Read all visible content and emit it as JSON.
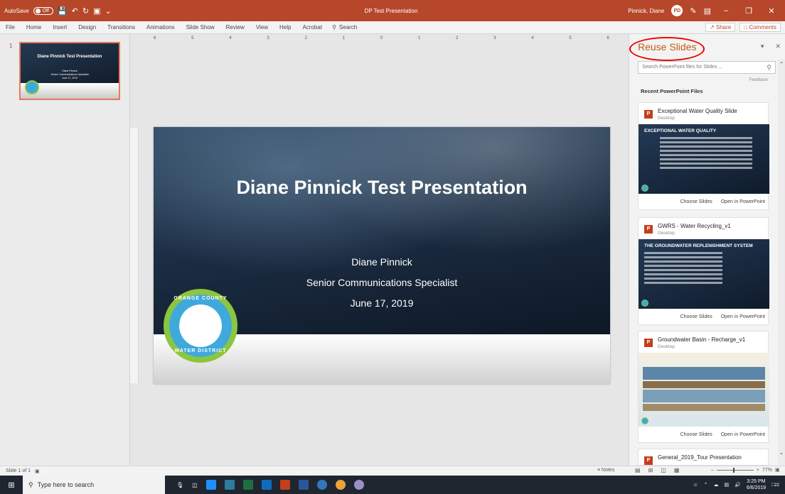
{
  "window": {
    "autosave_label": "AutoSave",
    "autosave_state": "Off",
    "title": "DP Test Presentation",
    "user_name": "Pinnick, Diane",
    "user_initials": "PD"
  },
  "ribbon": {
    "tabs": [
      "File",
      "Home",
      "Insert",
      "Design",
      "Transitions",
      "Animations",
      "Slide Show",
      "Review",
      "View",
      "Help",
      "Acrobat"
    ],
    "search_label": "Search",
    "share_label": "Share",
    "comments_label": "Comments"
  },
  "ruler_ticks": [
    "6",
    "5",
    "4",
    "3",
    "2",
    "1",
    "0",
    "1",
    "2",
    "3",
    "4",
    "5",
    "6"
  ],
  "thumbnails": [
    {
      "number": "1",
      "title": "Diane Pinnick Test Presentation",
      "line1": "Diane Pinnick",
      "line2": "Senior Communications Specialist",
      "line3": "June 17, 2019"
    }
  ],
  "slide": {
    "title": "Diane Pinnick Test Presentation",
    "name": "Diane Pinnick",
    "role": "Senior Communications Specialist",
    "date": "June 17, 2019",
    "logo_text_top": "ORANGE COUNTY",
    "logo_text_bottom": "WATER DISTRICT"
  },
  "reuse_pane": {
    "title": "Reuse Slides",
    "search_placeholder": "Search PowerPoint files for Slides ...",
    "feedback": "Feedback",
    "recent_label": "Recent PowerPoint Files",
    "files": [
      {
        "name": "Exceptional Water Quality Slide",
        "location": "Desktop",
        "preview_title": "EXCEPTIONAL WATER QUALITY",
        "choose": "Choose Slides",
        "open": "Open in PowerPoint"
      },
      {
        "name": "GWRS - Water Recycling_v1",
        "location": "Desktop",
        "preview_title": "THE GROUNDWATER REPLENISHMENT SYSTEM",
        "choose": "Choose Slides",
        "open": "Open in PowerPoint"
      },
      {
        "name": "Groundwater Basin - Recharge_v1",
        "location": "Desktop",
        "preview_title": "",
        "choose": "Choose Slides",
        "open": "Open in PowerPoint"
      },
      {
        "name": "General_2019_Tour Presentation",
        "location": "",
        "preview_title": "",
        "choose": "",
        "open": ""
      }
    ]
  },
  "statusbar": {
    "slide_count": "Slide 1 of 1",
    "notes": "Notes",
    "zoom": "77%"
  },
  "taskbar": {
    "search_placeholder": "Type here to search",
    "time": "3:25 PM",
    "date": "6/6/2019",
    "notification_count": "22"
  },
  "colors": {
    "accent": "#b7472a",
    "pane_title": "#c55a11",
    "annotation_circle": "#e00000"
  }
}
